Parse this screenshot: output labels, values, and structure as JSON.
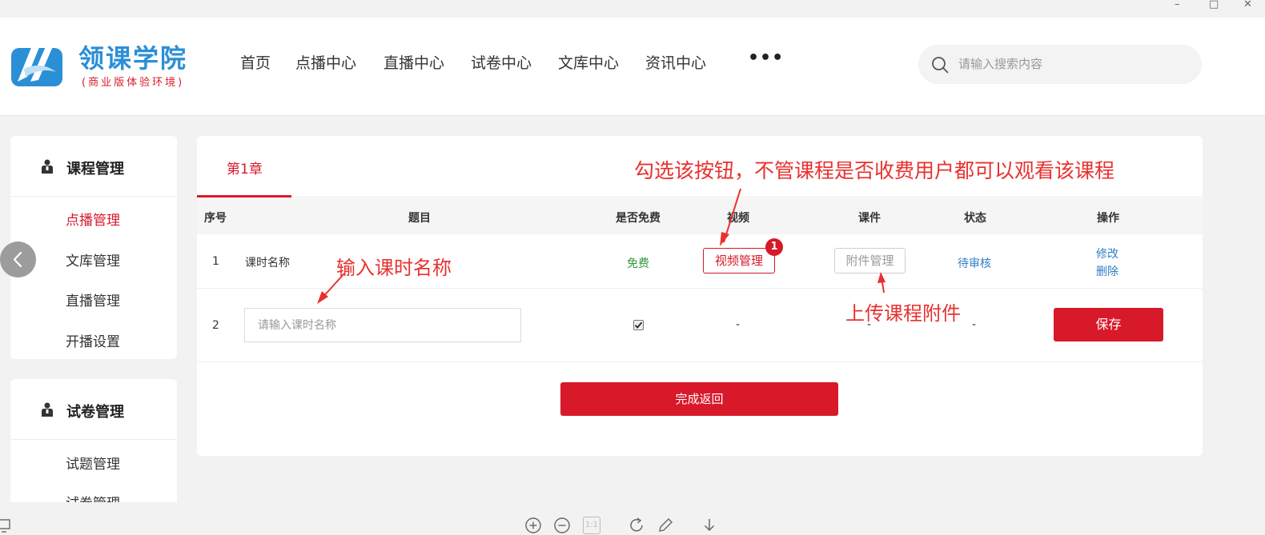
{
  "window": {
    "minimize": "–",
    "maximize": "□",
    "close": "✕"
  },
  "brand": {
    "name": "领课学院",
    "tagline": "(商业版体验环境)"
  },
  "nav": {
    "items": [
      "首页",
      "点播中心",
      "直播中心",
      "试卷中心",
      "文库中心",
      "资讯中心"
    ],
    "more": "•••"
  },
  "search": {
    "placeholder": "请输入搜索内容"
  },
  "sidebar": {
    "groups": [
      {
        "title": "课程管理",
        "items": [
          "点播管理",
          "文库管理",
          "直播管理",
          "开播设置"
        ],
        "active_index": 0
      },
      {
        "title": "试卷管理",
        "items": [
          "试题管理",
          "试卷管理"
        ]
      }
    ]
  },
  "panel": {
    "tab": "第1章",
    "columns": [
      "序号",
      "题目",
      "是否免费",
      "视频",
      "课件",
      "状态",
      "操作"
    ],
    "rows": [
      {
        "index": "1",
        "title": "课时名称",
        "free": "免费",
        "video_button": "视频管理",
        "badge": "1",
        "attachment_button": "附件管理",
        "status": "待审核",
        "actions": [
          "修改",
          "删除"
        ]
      },
      {
        "index": "2",
        "title_placeholder": "请输入课时名称",
        "free_checked": true,
        "video": "-",
        "attachment": "-",
        "status": "-",
        "save_button": "保存"
      }
    ],
    "done_button": "完成返回"
  },
  "annotations": {
    "free_hint": "勾选该按钮，不管课程是否收费用户都可以观看该课程",
    "name_hint": "输入课时名称",
    "upload_hint": "上传课程附件"
  },
  "viewer_toolbar": {
    "icons": [
      "monitor-icon",
      "zoom-in-icon",
      "zoom-out-icon",
      "actual-size-icon",
      "rotate-icon",
      "edit-icon",
      "download-icon"
    ],
    "actual_size_label": "1:1"
  },
  "colors": {
    "accent_red": "#d7192a",
    "brand_blue": "#2b8fd6",
    "link_blue": "#2f7ec9",
    "free_green": "#2e9b3a",
    "annotation_red": "#e8312f"
  }
}
